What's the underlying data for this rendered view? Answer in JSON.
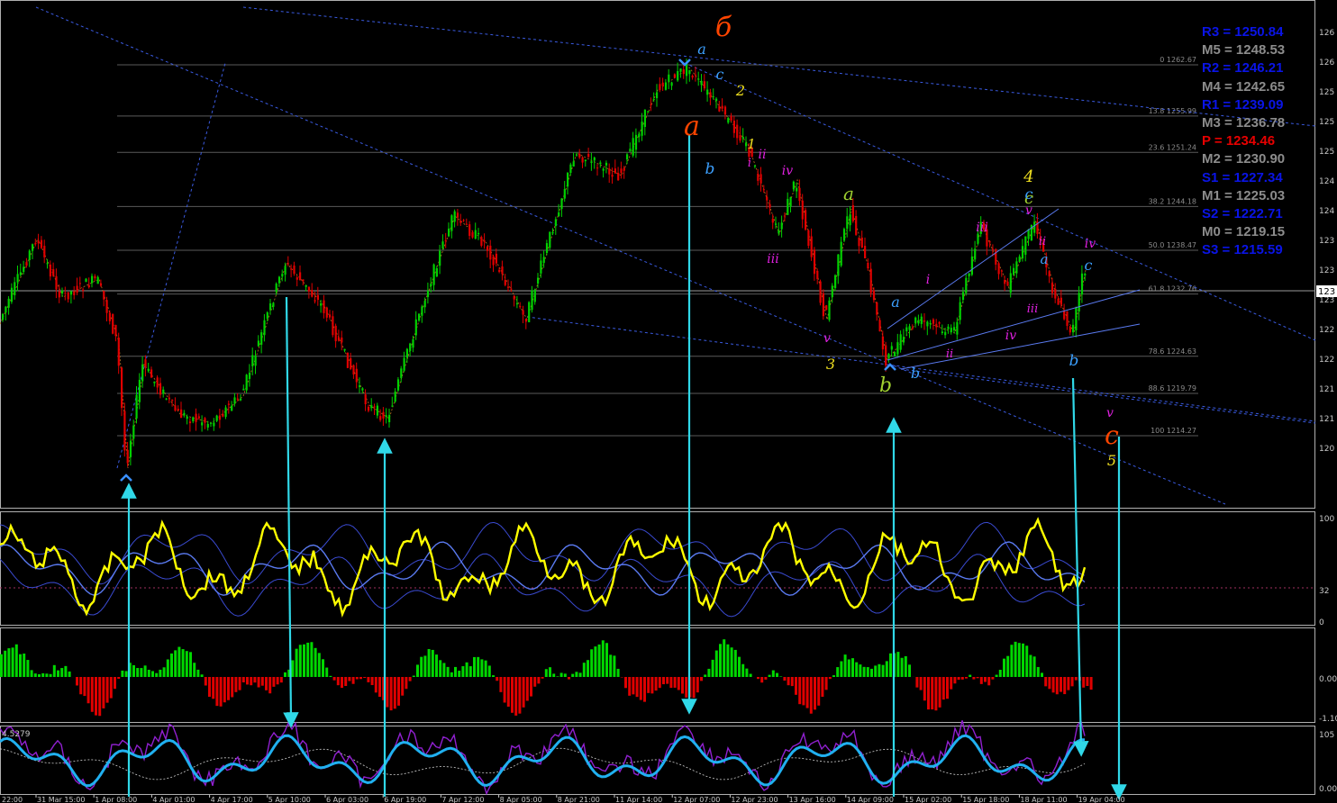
{
  "chart_data": {
    "type": "line",
    "symbol_context": "price candlesticks with Elliott wave labels and oscillators",
    "x_ticks": [
      "31 Mar 15:00",
      "1 Apr 08:00",
      "4 Apr 01:00",
      "4 Apr 17:00",
      "5 Apr 10:00",
      "6 Apr 03:00",
      "6 Apr 19:00",
      "7 Apr 12:00",
      "8 Apr 05:00",
      "8 Apr 21:00",
      "11 Apr 14:00",
      "12 Apr 07:00",
      "12 Apr 23:00",
      "13 Apr 16:00",
      "14 Apr 09:00",
      "15 Apr 02:00",
      "15 Apr 18:00",
      "18 Apr 11:00",
      "19 Apr 04:00"
    ],
    "x_tick_left_partial": "22:00",
    "y_ticks_main": [
      "126",
      "126",
      "125",
      "125",
      "125",
      "124",
      "124",
      "123",
      "123",
      "123",
      "122",
      "122",
      "121",
      "121",
      "120"
    ],
    "y_ticks_osc1": [
      "100",
      "32",
      "0"
    ],
    "y_ticks_osc2": [
      "0.00",
      "-1.10"
    ],
    "y_ticks_osc3": [
      "105",
      "0.00"
    ],
    "osc3_label": "4.5279",
    "current_price_tag": "123",
    "fib_levels": [
      {
        "label": "0 1262.67",
        "price": 1262.67
      },
      {
        "label": "13.8 1255.99",
        "price": 1255.99
      },
      {
        "label": "23.6 1251.24",
        "price": 1251.24
      },
      {
        "label": "38.2 1244.18",
        "price": 1244.18
      },
      {
        "label": "50.0 1238.47",
        "price": 1238.47
      },
      {
        "label": "61.8 1232.76",
        "price": 1232.76
      },
      {
        "label": "78.6 1224.63",
        "price": 1224.63
      },
      {
        "label": "88.6 1219.79",
        "price": 1219.79
      },
      {
        "label": "100 1214.27",
        "price": 1214.27
      }
    ],
    "pivots": [
      {
        "label": "R3 = 1250.84",
        "color": "#0a14e6"
      },
      {
        "label": "M5 = 1248.53",
        "color": "#8c8c8c"
      },
      {
        "label": "R2 = 1246.21",
        "color": "#0a14e6"
      },
      {
        "label": "M4 = 1242.65",
        "color": "#8c8c8c"
      },
      {
        "label": "R1 = 1239.09",
        "color": "#0a14e6"
      },
      {
        "label": "M3 = 1236.78",
        "color": "#8c8c8c"
      },
      {
        "label": "P  = 1234.46",
        "color": "#e60000"
      },
      {
        "label": "M2 = 1230.90",
        "color": "#8c8c8c"
      },
      {
        "label": "S1 = 1227.34",
        "color": "#0a14e6"
      },
      {
        "label": "M1 = 1225.03",
        "color": "#8c8c8c"
      },
      {
        "label": "S2 = 1222.71",
        "color": "#0a14e6"
      },
      {
        "label": "M0 = 1219.15",
        "color": "#8c8c8c"
      },
      {
        "label": "S3 = 1215.59",
        "color": "#0a14e6"
      }
    ],
    "wave_labels": [
      {
        "text": "б",
        "color": "#ff4500"
      },
      {
        "text": "a",
        "color": "#3ca0ff"
      },
      {
        "text": "c",
        "color": "#3ca0ff"
      },
      {
        "text": "2",
        "color": "#f0e020"
      },
      {
        "text": "a",
        "color": "#ff4500"
      },
      {
        "text": "ii",
        "color": "#e020e0"
      },
      {
        "text": "1",
        "color": "#f0e020"
      },
      {
        "text": "iv",
        "color": "#e020e0"
      },
      {
        "text": "i",
        "color": "#e020e0"
      },
      {
        "text": "b",
        "color": "#3ca0ff"
      },
      {
        "text": "iii",
        "color": "#e020e0"
      },
      {
        "text": "a",
        "color": "#a0d030"
      },
      {
        "text": "v",
        "color": "#e020e0"
      },
      {
        "text": "3",
        "color": "#f0e020"
      },
      {
        "text": "b",
        "color": "#a0d030"
      },
      {
        "text": "a",
        "color": "#3ca0ff"
      },
      {
        "text": "b",
        "color": "#3ca0ff"
      },
      {
        "text": "i",
        "color": "#e020e0"
      },
      {
        "text": "ii",
        "color": "#e020e0"
      },
      {
        "text": "iii",
        "color": "#e020e0"
      },
      {
        "text": "iv",
        "color": "#e020e0"
      },
      {
        "text": "4",
        "color": "#f0e020"
      },
      {
        "text": "c",
        "color": "#a0d030"
      },
      {
        "text": "c",
        "color": "#3ca0ff"
      },
      {
        "text": "v",
        "color": "#e020e0"
      },
      {
        "text": "ii",
        "color": "#e020e0"
      },
      {
        "text": "a",
        "color": "#3ca0ff"
      },
      {
        "text": "iii",
        "color": "#e020e0"
      },
      {
        "text": "iv",
        "color": "#e020e0"
      },
      {
        "text": "c",
        "color": "#3ca0ff"
      },
      {
        "text": "b",
        "color": "#3ca0ff"
      },
      {
        "text": "v",
        "color": "#e020e0"
      },
      {
        "text": "c",
        "color": "#ff4500"
      },
      {
        "text": "5",
        "color": "#f0e020"
      }
    ],
    "colors": {
      "bull": "#00d000",
      "bear": "#e00000",
      "cyan_arrows": "#30d8e8",
      "stoch": "#ffff00",
      "hist_pos": "#00d800",
      "hist_neg": "#e00000",
      "osc3_main": "#20b0f0",
      "osc3_alt": "#9020d0"
    }
  }
}
